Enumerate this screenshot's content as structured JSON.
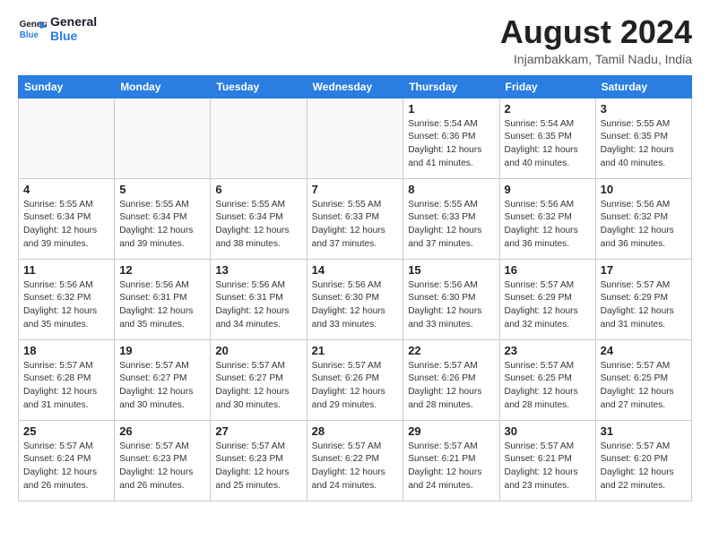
{
  "header": {
    "logo_line1": "General",
    "logo_line2": "Blue",
    "month_year": "August 2024",
    "location": "Injambakkam, Tamil Nadu, India"
  },
  "days_of_week": [
    "Sunday",
    "Monday",
    "Tuesday",
    "Wednesday",
    "Thursday",
    "Friday",
    "Saturday"
  ],
  "weeks": [
    [
      {
        "day": "",
        "info": ""
      },
      {
        "day": "",
        "info": ""
      },
      {
        "day": "",
        "info": ""
      },
      {
        "day": "",
        "info": ""
      },
      {
        "day": "1",
        "info": "Sunrise: 5:54 AM\nSunset: 6:36 PM\nDaylight: 12 hours\nand 41 minutes."
      },
      {
        "day": "2",
        "info": "Sunrise: 5:54 AM\nSunset: 6:35 PM\nDaylight: 12 hours\nand 40 minutes."
      },
      {
        "day": "3",
        "info": "Sunrise: 5:55 AM\nSunset: 6:35 PM\nDaylight: 12 hours\nand 40 minutes."
      }
    ],
    [
      {
        "day": "4",
        "info": "Sunrise: 5:55 AM\nSunset: 6:34 PM\nDaylight: 12 hours\nand 39 minutes."
      },
      {
        "day": "5",
        "info": "Sunrise: 5:55 AM\nSunset: 6:34 PM\nDaylight: 12 hours\nand 39 minutes."
      },
      {
        "day": "6",
        "info": "Sunrise: 5:55 AM\nSunset: 6:34 PM\nDaylight: 12 hours\nand 38 minutes."
      },
      {
        "day": "7",
        "info": "Sunrise: 5:55 AM\nSunset: 6:33 PM\nDaylight: 12 hours\nand 37 minutes."
      },
      {
        "day": "8",
        "info": "Sunrise: 5:55 AM\nSunset: 6:33 PM\nDaylight: 12 hours\nand 37 minutes."
      },
      {
        "day": "9",
        "info": "Sunrise: 5:56 AM\nSunset: 6:32 PM\nDaylight: 12 hours\nand 36 minutes."
      },
      {
        "day": "10",
        "info": "Sunrise: 5:56 AM\nSunset: 6:32 PM\nDaylight: 12 hours\nand 36 minutes."
      }
    ],
    [
      {
        "day": "11",
        "info": "Sunrise: 5:56 AM\nSunset: 6:32 PM\nDaylight: 12 hours\nand 35 minutes."
      },
      {
        "day": "12",
        "info": "Sunrise: 5:56 AM\nSunset: 6:31 PM\nDaylight: 12 hours\nand 35 minutes."
      },
      {
        "day": "13",
        "info": "Sunrise: 5:56 AM\nSunset: 6:31 PM\nDaylight: 12 hours\nand 34 minutes."
      },
      {
        "day": "14",
        "info": "Sunrise: 5:56 AM\nSunset: 6:30 PM\nDaylight: 12 hours\nand 33 minutes."
      },
      {
        "day": "15",
        "info": "Sunrise: 5:56 AM\nSunset: 6:30 PM\nDaylight: 12 hours\nand 33 minutes."
      },
      {
        "day": "16",
        "info": "Sunrise: 5:57 AM\nSunset: 6:29 PM\nDaylight: 12 hours\nand 32 minutes."
      },
      {
        "day": "17",
        "info": "Sunrise: 5:57 AM\nSunset: 6:29 PM\nDaylight: 12 hours\nand 31 minutes."
      }
    ],
    [
      {
        "day": "18",
        "info": "Sunrise: 5:57 AM\nSunset: 6:28 PM\nDaylight: 12 hours\nand 31 minutes."
      },
      {
        "day": "19",
        "info": "Sunrise: 5:57 AM\nSunset: 6:27 PM\nDaylight: 12 hours\nand 30 minutes."
      },
      {
        "day": "20",
        "info": "Sunrise: 5:57 AM\nSunset: 6:27 PM\nDaylight: 12 hours\nand 30 minutes."
      },
      {
        "day": "21",
        "info": "Sunrise: 5:57 AM\nSunset: 6:26 PM\nDaylight: 12 hours\nand 29 minutes."
      },
      {
        "day": "22",
        "info": "Sunrise: 5:57 AM\nSunset: 6:26 PM\nDaylight: 12 hours\nand 28 minutes."
      },
      {
        "day": "23",
        "info": "Sunrise: 5:57 AM\nSunset: 6:25 PM\nDaylight: 12 hours\nand 28 minutes."
      },
      {
        "day": "24",
        "info": "Sunrise: 5:57 AM\nSunset: 6:25 PM\nDaylight: 12 hours\nand 27 minutes."
      }
    ],
    [
      {
        "day": "25",
        "info": "Sunrise: 5:57 AM\nSunset: 6:24 PM\nDaylight: 12 hours\nand 26 minutes."
      },
      {
        "day": "26",
        "info": "Sunrise: 5:57 AM\nSunset: 6:23 PM\nDaylight: 12 hours\nand 26 minutes."
      },
      {
        "day": "27",
        "info": "Sunrise: 5:57 AM\nSunset: 6:23 PM\nDaylight: 12 hours\nand 25 minutes."
      },
      {
        "day": "28",
        "info": "Sunrise: 5:57 AM\nSunset: 6:22 PM\nDaylight: 12 hours\nand 24 minutes."
      },
      {
        "day": "29",
        "info": "Sunrise: 5:57 AM\nSunset: 6:21 PM\nDaylight: 12 hours\nand 24 minutes."
      },
      {
        "day": "30",
        "info": "Sunrise: 5:57 AM\nSunset: 6:21 PM\nDaylight: 12 hours\nand 23 minutes."
      },
      {
        "day": "31",
        "info": "Sunrise: 5:57 AM\nSunset: 6:20 PM\nDaylight: 12 hours\nand 22 minutes."
      }
    ]
  ]
}
